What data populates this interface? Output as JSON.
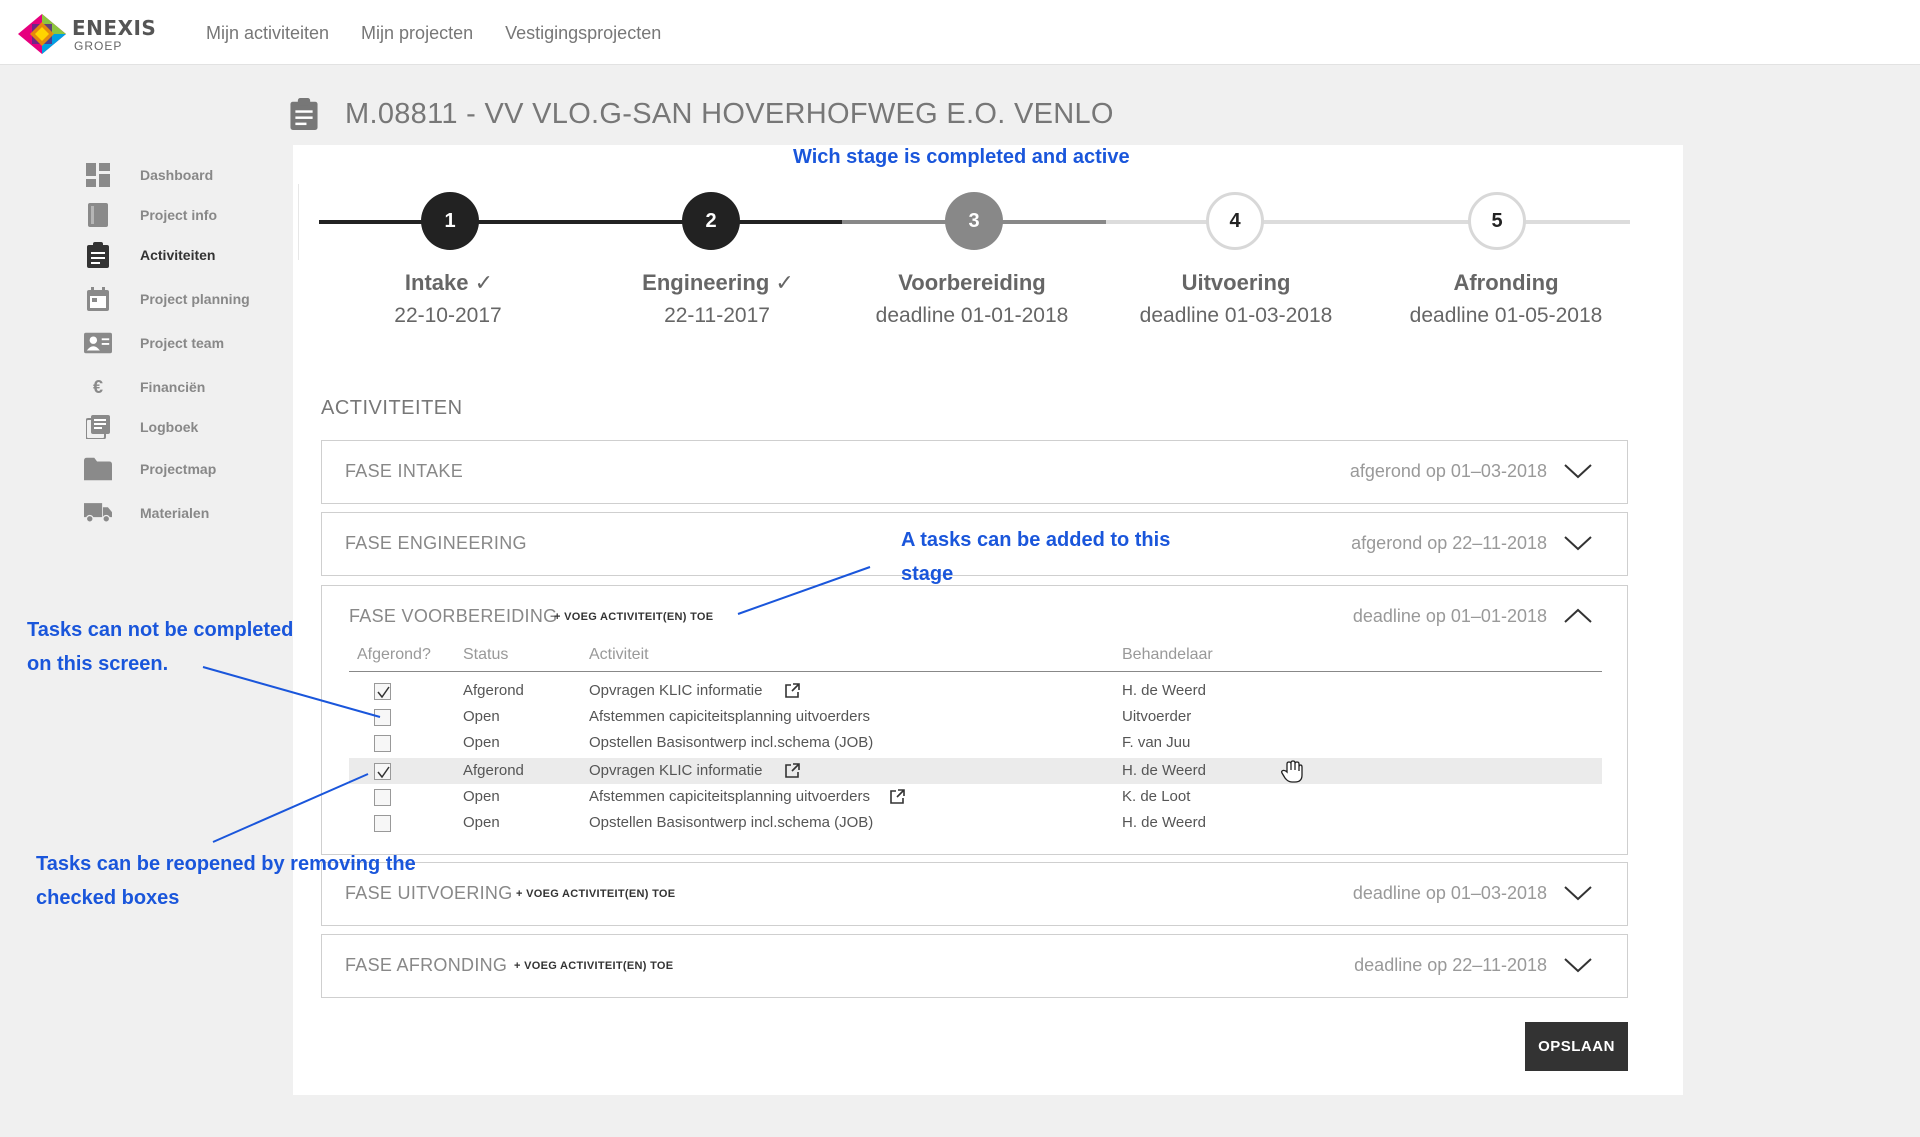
{
  "brand": {
    "name": "ENEXIS",
    "sub": "GROEP"
  },
  "topnav": [
    "Mijn activiteiten",
    "Mijn projecten",
    "Vestigingsprojecten"
  ],
  "sidebar": {
    "items": [
      {
        "label": "Dashboard",
        "icon": "dashboard-icon"
      },
      {
        "label": "Project info",
        "icon": "book-icon"
      },
      {
        "label": "Activiteiten",
        "icon": "clipboard-icon"
      },
      {
        "label": "Project planning",
        "icon": "calendar-icon"
      },
      {
        "label": "Project team",
        "icon": "team-card-icon"
      },
      {
        "label": "Financiën",
        "icon": "euro-icon"
      },
      {
        "label": "Logboek",
        "icon": "logbook-icon"
      },
      {
        "label": "Projectmap",
        "icon": "folder-icon"
      },
      {
        "label": "Materialen",
        "icon": "truck-icon"
      }
    ],
    "active": "Activiteiten"
  },
  "page_title": "M.08811 - VV VLO.G-SAN HOVERHOFWEG E.O. VENLO",
  "annotations": {
    "stage": "Wich stage is completed and active",
    "add_task_1": "A tasks can be added to this",
    "add_task_2": "stage",
    "not_complete_1": "Tasks can not be completed",
    "not_complete_2": "on this screen.",
    "reopen_1": "Tasks can be reopened by removing the",
    "reopen_2": "checked boxes"
  },
  "stepper": [
    {
      "num": "1",
      "name": "Intake",
      "date": "22-10-2017",
      "state": "done"
    },
    {
      "num": "2",
      "name": "Engineering",
      "date": "22-11-2017",
      "state": "done"
    },
    {
      "num": "3",
      "name": "Voorbereiding",
      "date": "deadline 01-01-2018",
      "state": "active"
    },
    {
      "num": "4",
      "name": "Uitvoering",
      "date": "deadline 01-03-2018",
      "state": "future"
    },
    {
      "num": "5",
      "name": "Afronding",
      "date": "deadline 01-05-2018",
      "state": "future"
    }
  ],
  "section_heading": "ACTIVITEITEN",
  "add_label": "+ VOEG ACTIVITEIT(EN) TOE",
  "phases": {
    "intake": {
      "title": "FASE INTAKE",
      "status": "afgerond op 01–03-2018"
    },
    "engineering": {
      "title": "FASE ENGINEERING",
      "status": "afgerond op 22–11-2018"
    },
    "voorbereiding": {
      "title": "FASE VOORBEREIDING",
      "status": "deadline op 01–01-2018"
    },
    "uitvoering": {
      "title": "FASE UITVOERING",
      "status": "deadline op 01–03-2018"
    },
    "afronding": {
      "title": "FASE AFRONDING",
      "status": "deadline op 22–11-2018"
    }
  },
  "table": {
    "headers": {
      "done": "Afgerond?",
      "status": "Status",
      "activity": "Activiteit",
      "handler": "Behandelaar"
    },
    "rows": [
      {
        "checked": true,
        "status": "Afgerond",
        "activity": "Opvragen KLIC informatie",
        "handler": "H. de Weerd",
        "link": true
      },
      {
        "checked": false,
        "status": "Open",
        "activity": "Afstemmen capiciteitsplanning uitvoerders",
        "handler": "Uitvoerder",
        "link": false
      },
      {
        "checked": false,
        "status": "Open",
        "activity": "Opstellen Basisontwerp incl.schema (JOB)",
        "handler": "F. van Juu",
        "link": false
      },
      {
        "checked": true,
        "status": "Afgerond",
        "activity": "Opvragen KLIC informatie",
        "handler": "H. de Weerd",
        "link": true
      },
      {
        "checked": false,
        "status": "Open",
        "activity": "Afstemmen capiciteitsplanning uitvoerders",
        "handler": "K. de Loot",
        "link": true
      },
      {
        "checked": false,
        "status": "Open",
        "activity": "Opstellen Basisontwerp incl.schema (JOB)",
        "handler": "H. de Weerd",
        "link": false
      }
    ]
  },
  "save_label": "OPSLAAN",
  "colors": {
    "annotation": "#1a56db",
    "done": "#222222",
    "active": "#888888",
    "save": "#333333"
  }
}
